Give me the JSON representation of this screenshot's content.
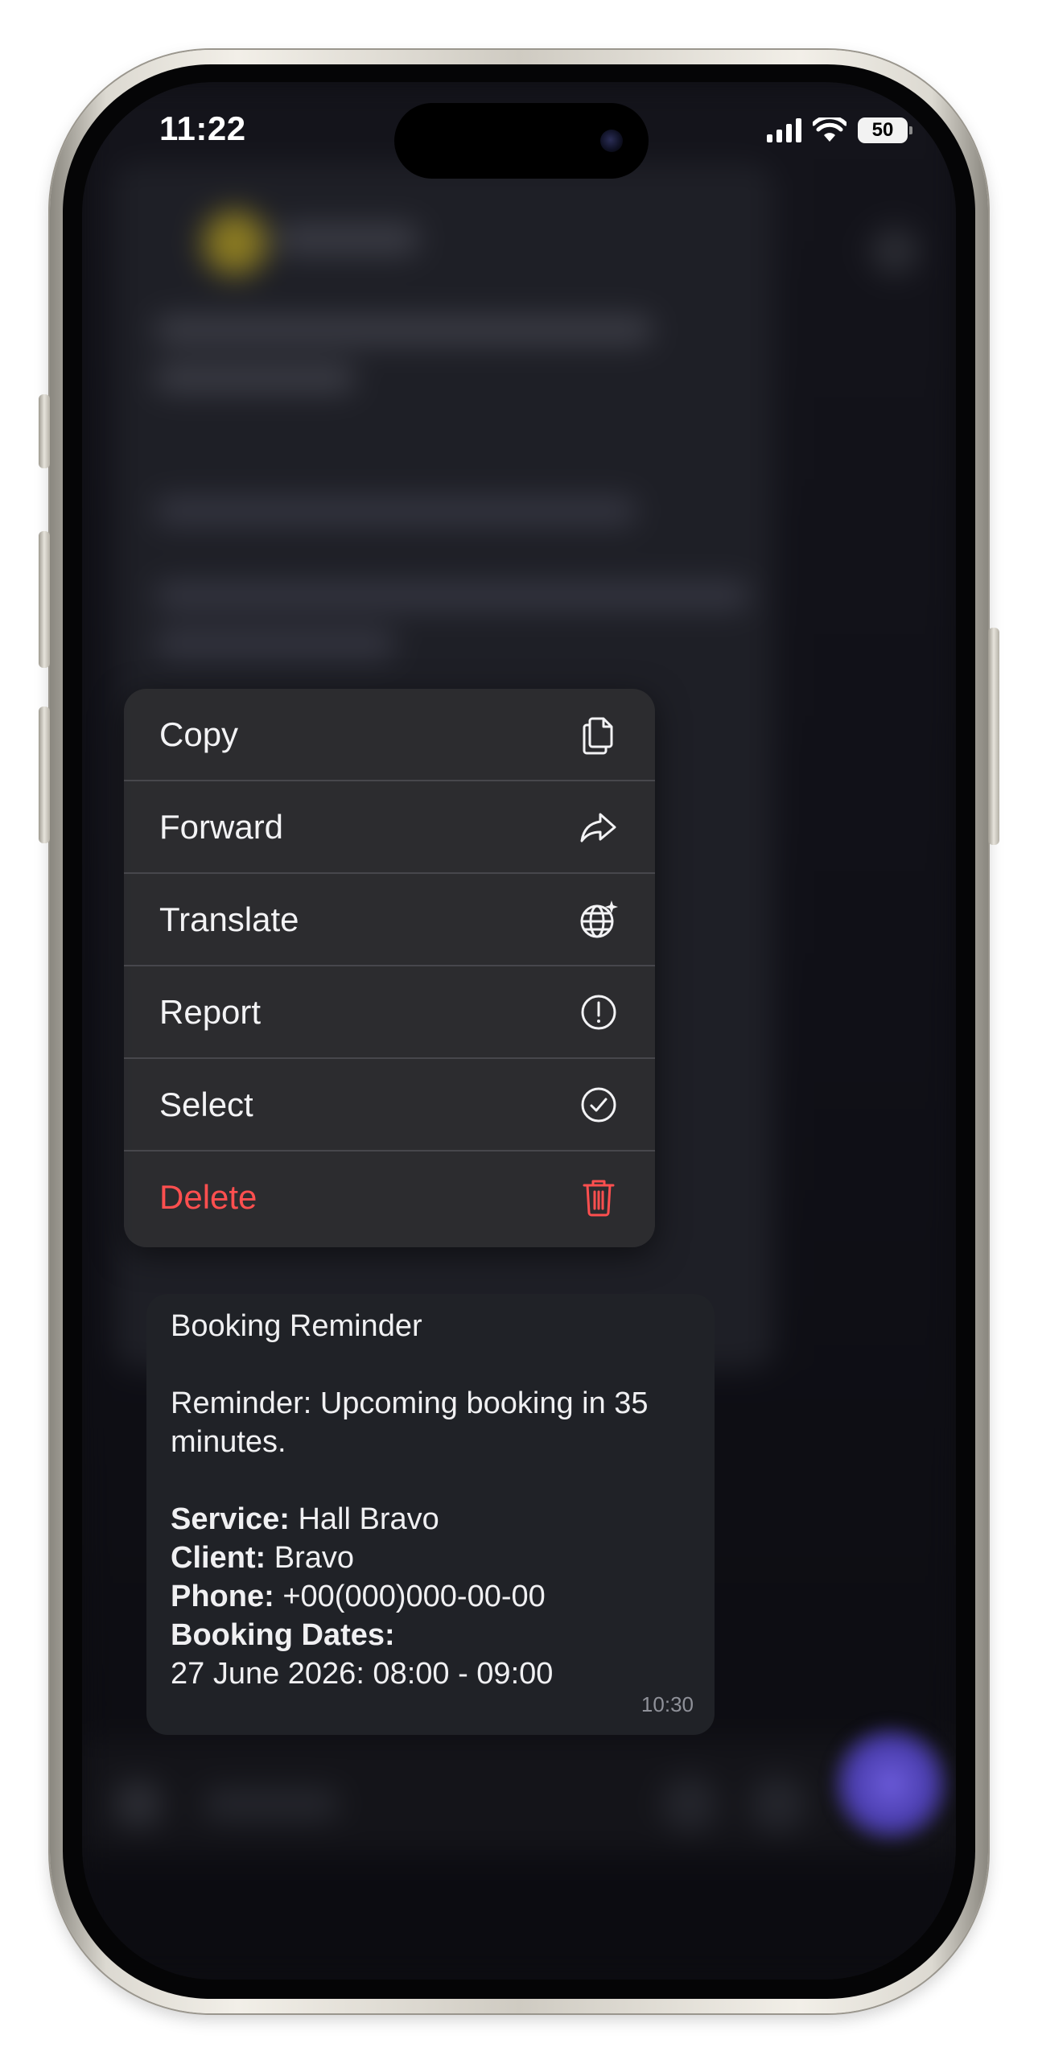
{
  "status_bar": {
    "time": "11:22",
    "battery": "50",
    "icons": [
      "cellular-signal-icon",
      "wifi-icon",
      "battery-icon"
    ]
  },
  "context_menu": {
    "items": [
      {
        "label": "Copy",
        "icon": "copy-icon",
        "color": "#f3f3f5"
      },
      {
        "label": "Forward",
        "icon": "forward-icon",
        "color": "#f3f3f5"
      },
      {
        "label": "Translate",
        "icon": "translate-globe-icon",
        "color": "#f3f3f5"
      },
      {
        "label": "Report",
        "icon": "report-exclamation-icon",
        "color": "#f3f3f5"
      },
      {
        "label": "Select",
        "icon": "select-checkmark-icon",
        "color": "#f3f3f5"
      },
      {
        "label": "Delete",
        "icon": "trash-icon",
        "color": "#ff4f4f"
      }
    ]
  },
  "message": {
    "title": "Booking Reminder",
    "body": "Reminder: Upcoming booking in 35 minutes.",
    "service_label": "Service:",
    "service_value": " Hall Bravo",
    "client_label": "Client:",
    "client_value": " Bravo",
    "phone_label": "Phone:",
    "phone_value": " +00(000)000-00-00",
    "dates_label": "Booking Dates:",
    "dates_value": "27 June 2026: 08:00 - 09:00",
    "time": "10:30"
  },
  "colors": {
    "accent_purple": "#6a5ad8",
    "danger_red": "#ff4f4f",
    "menu_bg": "#2c2c30",
    "bubble_bg": "#202227"
  }
}
